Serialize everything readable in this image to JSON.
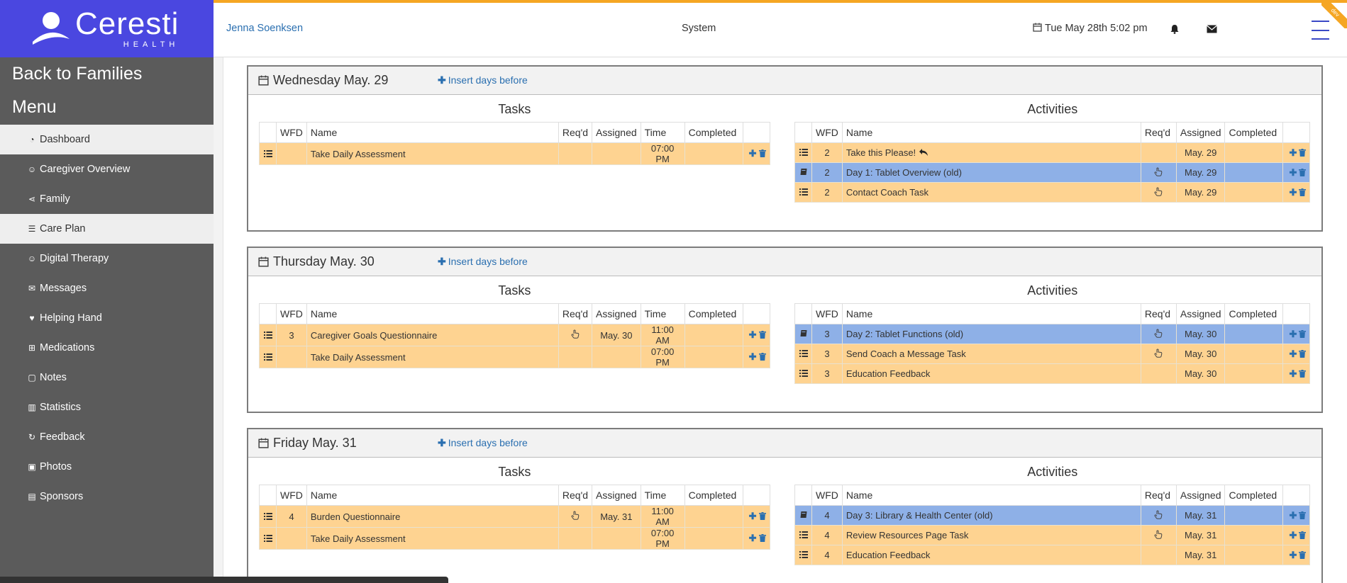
{
  "sidebar": {
    "brand_name": "Ceresti",
    "brand_sub": "HEALTH",
    "back_label": "Back to Families",
    "menu_label": "Menu",
    "items": [
      {
        "label": "Dashboard",
        "icon": "dashboard-icon"
      },
      {
        "label": "Caregiver Overview",
        "icon": "user-icon"
      },
      {
        "label": "Family",
        "icon": "share-icon"
      },
      {
        "label": "Care Plan",
        "icon": "list-icon"
      },
      {
        "label": "Digital Therapy",
        "icon": "smile-icon"
      },
      {
        "label": "Messages",
        "icon": "comments-icon"
      },
      {
        "label": "Helping Hand",
        "icon": "heart-icon"
      },
      {
        "label": "Medications",
        "icon": "medkit-icon"
      },
      {
        "label": "Notes",
        "icon": "note-icon"
      },
      {
        "label": "Statistics",
        "icon": "bar-chart-icon"
      },
      {
        "label": "Feedback",
        "icon": "refresh-icon"
      },
      {
        "label": "Photos",
        "icon": "image-icon"
      },
      {
        "label": "Sponsors",
        "icon": "id-card-icon"
      }
    ]
  },
  "header": {
    "user": "Jenna Soenksen",
    "system": "System",
    "date": "Tue May 28th 5:02 pm",
    "ribbon": "dev"
  },
  "labels": {
    "insert": "Insert days before",
    "tasks": "Tasks",
    "activities": "Activities"
  },
  "columns": {
    "tasks": [
      "",
      "WFD",
      "Name",
      "Req'd",
      "Assigned",
      "Time",
      "Completed",
      ""
    ],
    "activities": [
      "",
      "WFD",
      "Name",
      "Req'd",
      "Assigned",
      "Completed",
      ""
    ]
  },
  "days": [
    {
      "title": "Wednesday May. 29",
      "tasks": [
        {
          "wfd": "",
          "name": "Take Daily Assessment",
          "req": false,
          "assigned": "",
          "time": "07:00 PM",
          "completed": ""
        }
      ],
      "activities": [
        {
          "type": "list",
          "wfd": "2",
          "name": "Take this Please!",
          "reply": true,
          "req": false,
          "assigned": "May. 29",
          "completed": ""
        },
        {
          "type": "book",
          "wfd": "2",
          "name": "Day 1: Tablet Overview (old)",
          "reply": false,
          "req": true,
          "assigned": "May. 29",
          "completed": ""
        },
        {
          "type": "list",
          "wfd": "2",
          "name": "Contact Coach Task",
          "reply": false,
          "req": true,
          "assigned": "May. 29",
          "completed": ""
        }
      ]
    },
    {
      "title": "Thursday May. 30",
      "tasks": [
        {
          "wfd": "3",
          "name": "Caregiver Goals Questionnaire",
          "req": true,
          "assigned": "May. 30",
          "time": "11:00 AM",
          "completed": ""
        },
        {
          "wfd": "",
          "name": "Take Daily Assessment",
          "req": false,
          "assigned": "",
          "time": "07:00 PM",
          "completed": ""
        }
      ],
      "activities": [
        {
          "type": "book",
          "wfd": "3",
          "name": "Day 2: Tablet Functions (old)",
          "reply": false,
          "req": true,
          "assigned": "May. 30",
          "completed": ""
        },
        {
          "type": "list",
          "wfd": "3",
          "name": "Send Coach a Message Task",
          "reply": false,
          "req": true,
          "assigned": "May. 30",
          "completed": ""
        },
        {
          "type": "list",
          "wfd": "3",
          "name": "Education Feedback",
          "reply": false,
          "req": false,
          "assigned": "May. 30",
          "completed": ""
        }
      ]
    },
    {
      "title": "Friday May. 31",
      "tasks": [
        {
          "wfd": "4",
          "name": "Burden Questionnaire",
          "req": true,
          "assigned": "May. 31",
          "time": "11:00 AM",
          "completed": ""
        },
        {
          "wfd": "",
          "name": "Take Daily Assessment",
          "req": false,
          "assigned": "",
          "time": "07:00 PM",
          "completed": ""
        }
      ],
      "activities": [
        {
          "type": "book",
          "wfd": "4",
          "name": "Day 3: Library & Health Center (old)",
          "reply": false,
          "req": true,
          "assigned": "May. 31",
          "completed": ""
        },
        {
          "type": "list",
          "wfd": "4",
          "name": "Review Resources Page Task",
          "reply": false,
          "req": true,
          "assigned": "May. 31",
          "completed": ""
        },
        {
          "type": "list",
          "wfd": "4",
          "name": "Education Feedback",
          "reply": false,
          "req": false,
          "assigned": "May. 31",
          "completed": ""
        }
      ]
    }
  ],
  "colors": {
    "sidebar": "#5b5b5b",
    "logo_bg": "#4a47e0",
    "accent": "#f5a623",
    "task_row": "#fed391",
    "lesson_row": "#8eb0e7",
    "link": "#2a6fb0"
  }
}
